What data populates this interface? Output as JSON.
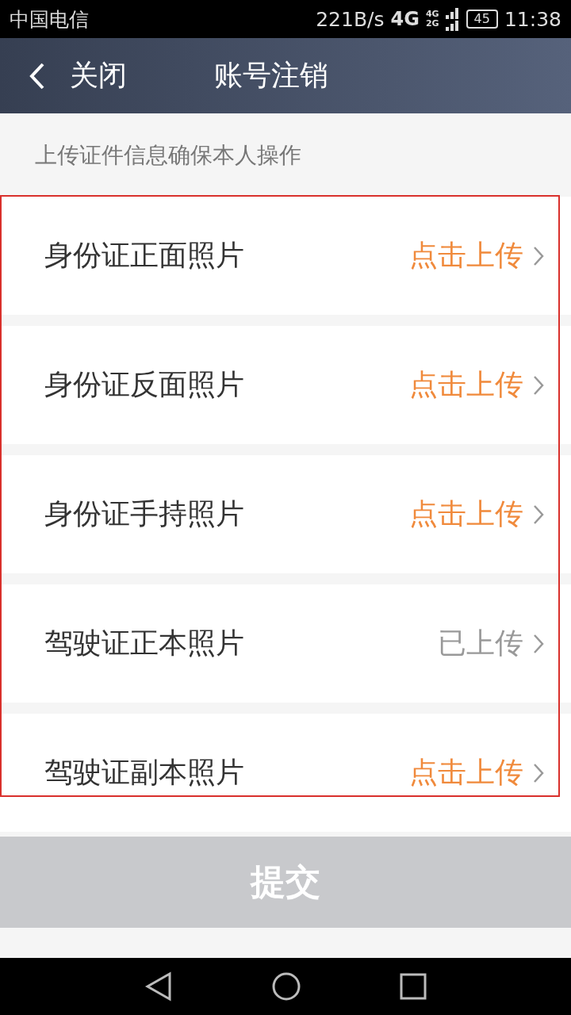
{
  "status_bar": {
    "carrier": "中国电信",
    "speed": "221B/s",
    "network": "4G",
    "network_small": [
      "4G",
      "2G"
    ],
    "battery": "45",
    "time": "11:38"
  },
  "header": {
    "back_label": "关闭",
    "title": "账号注销"
  },
  "subtitle": "上传证件信息确保本人操作",
  "rows": [
    {
      "label": "身份证正面照片",
      "status": "点击上传",
      "uploaded": false
    },
    {
      "label": "身份证反面照片",
      "status": "点击上传",
      "uploaded": false
    },
    {
      "label": "身份证手持照片",
      "status": "点击上传",
      "uploaded": false
    },
    {
      "label": "驾驶证正本照片",
      "status": "已上传",
      "uploaded": true
    },
    {
      "label": "驾驶证副本照片",
      "status": "点击上传",
      "uploaded": false
    }
  ],
  "submit_button": "提交"
}
